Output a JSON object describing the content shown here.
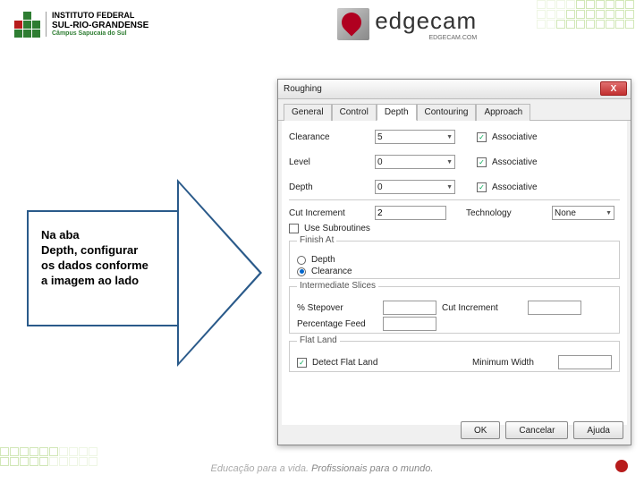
{
  "header": {
    "inst1": "INSTITUTO FEDERAL",
    "inst2": "SUL-RIO-GRANDENSE",
    "inst3": "Câmpus Sapucaia do Sul",
    "brand": "edgecam",
    "brand_sub": "EDGECAM.COM"
  },
  "arrow": {
    "l1": "Na aba",
    "l2": "Depth, configurar",
    "l3": "os dados conforme",
    "l4": "a imagem ao lado"
  },
  "dialog": {
    "title": "Roughing",
    "close": "X",
    "tabs": [
      "General",
      "Control",
      "Depth",
      "Contouring",
      "Approach"
    ],
    "fields": {
      "clearance_lbl": "Clearance",
      "clearance_val": "5",
      "assoc1_lbl": "Associative",
      "level_lbl": "Level",
      "level_val": "0",
      "assoc2_lbl": "Associative",
      "depth_lbl": "Depth",
      "depth_val": "0",
      "assoc3_lbl": "Associative",
      "cutinc_lbl": "Cut Increment",
      "cutinc_val": "2",
      "tech_lbl": "Technology",
      "tech_val": "None",
      "use_sub_lbl": "Use Subroutines",
      "finish_at": "Finish At",
      "finish_depth": "Depth",
      "finish_clearance": "Clearance",
      "inter_slices": "Intermediate Slices",
      "pct_stepover": "% Stepover",
      "cutinc2_lbl": "Cut Increment",
      "pct_feed": "Percentage Feed",
      "flat_land": "Flat Land",
      "detect_flat": "Detect Flat Land",
      "min_width": "Minimum Width"
    },
    "buttons": {
      "ok": "OK",
      "cancel": "Cancelar",
      "help": "Ajuda"
    }
  },
  "footer": {
    "t1": "Educação para a vida. ",
    "t2": "Profissionais para o mundo."
  }
}
